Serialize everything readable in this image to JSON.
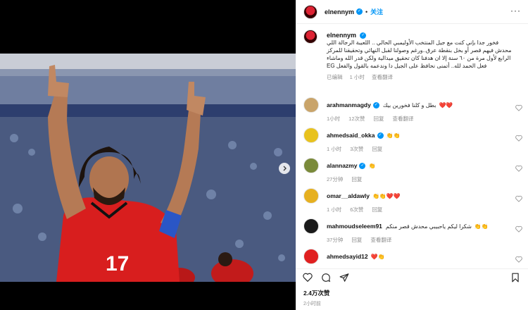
{
  "post": {
    "username": "elnennym",
    "follow_label": "关注",
    "caption": "فخور جدا بإني كنت مع جيل المنتخب الأوليمبي الحالي .. اللعيبة الرجالة اللي محدش فيهم قصر أو بخل بنقطة عرق..ورغم وصولنا لقبل النهائي وتحقيقنا للمركز الرابع لأول مرة من ٦٠ سنة إلا ان هدفنا كان تحقيق ميدالية ولكن قدر الله وماشاء فعل الحمد لله.. أتمنى نحافظ على الجيل دا وندعمه بالقول والفعل EG",
    "caption_meta": [
      "已编辑",
      "1 小时",
      "查看翻译"
    ],
    "likes": "2.4万次赞",
    "time": "2小时前"
  },
  "comments": [
    {
      "user": "arahmanmagdy",
      "verified": true,
      "text": "بطل و كلنا فخورين بيك",
      "emojis": "❤️❤️",
      "meta": [
        "1小时",
        "12次赞",
        "回复",
        "查看翻译"
      ],
      "avatar_color": "#c9a46a"
    },
    {
      "user": "ahmedsaid_okka",
      "verified": true,
      "text": "",
      "emojis": "👏👏",
      "meta": [
        "1 小时",
        "3次赞",
        "回复"
      ],
      "avatar_color": "#e8c21e"
    },
    {
      "user": "alannazmy",
      "verified": true,
      "text": "",
      "emojis": "👏",
      "meta": [
        "27分钟",
        "回复"
      ],
      "avatar_color": "#7a8a3a"
    },
    {
      "user": "omar__aldawly",
      "verified": false,
      "text": "",
      "emojis": "👏👏❤️❤️",
      "meta": [
        "1 小时",
        "6次赞",
        "回复"
      ],
      "avatar_color": "#e6b020"
    },
    {
      "user": "mahmoudseleem91",
      "verified": false,
      "text": "شكرا ليكم ياحبيبي محدش قصر منكم",
      "emojis": "👏👏",
      "meta": [
        "37分钟",
        "回复",
        "查看翻译"
      ],
      "avatar_color": "#1a1a1a"
    },
    {
      "user": "ahmedsayid12",
      "verified": false,
      "text": "",
      "emojis": "❤️👏",
      "meta": [],
      "avatar_color": "#e02020"
    }
  ],
  "colors": {
    "accent": "#0095f6",
    "jersey": "#d81e1e",
    "armband": "#2a56c6"
  },
  "icons": {
    "carousel_next": "chevron-right-icon",
    "like": "heart-icon",
    "comment": "comment-icon",
    "share": "send-icon",
    "save": "bookmark-icon",
    "more": "more-icon"
  }
}
